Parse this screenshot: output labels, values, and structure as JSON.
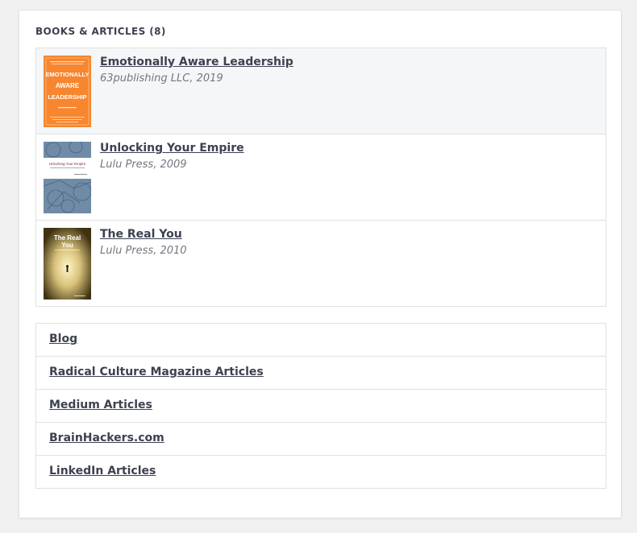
{
  "section": {
    "title": "BOOKS & ARTICLES (8)"
  },
  "books": [
    {
      "title": "Emotionally Aware Leadership",
      "meta": "63publishing LLC, 2019",
      "cover": {
        "lines": [
          "EMOTIONALLY",
          "AWARE",
          "LEADERSHIP"
        ],
        "bg": "#f7862f"
      }
    },
    {
      "title": "Unlocking Your Empire",
      "meta": "Lulu Press, 2009",
      "cover": {
        "lines": [
          "Unlocking Your Empire"
        ],
        "bg": "#5b7a99"
      }
    },
    {
      "title": "The Real You",
      "meta": "Lulu Press, 2010",
      "cover": {
        "lines": [
          "The Real",
          "You"
        ],
        "bg": "#5a4a22"
      }
    }
  ],
  "links": [
    {
      "label": "Blog"
    },
    {
      "label": "Radical Culture Magazine Articles"
    },
    {
      "label": "Medium Articles"
    },
    {
      "label": "BrainHackers.com"
    },
    {
      "label": "LinkedIn Articles"
    }
  ]
}
